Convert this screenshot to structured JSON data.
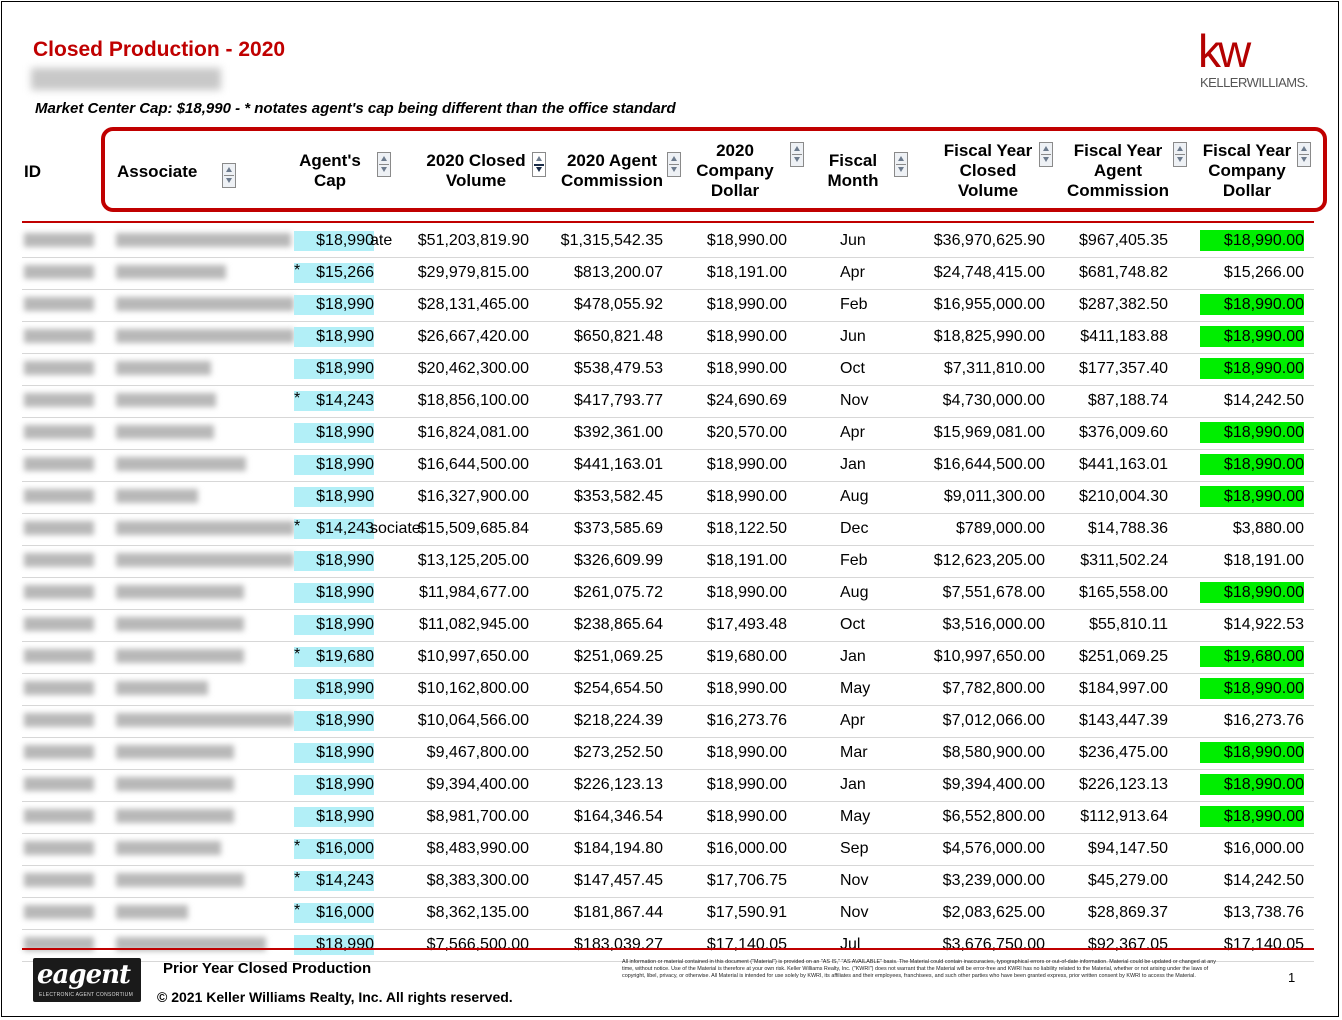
{
  "report": {
    "title": "Closed Production - 2020",
    "market_center_note": "Market Center Cap:  $18,990 - * notates agent's cap being different than the office standard"
  },
  "logo": {
    "mark": "kw",
    "text": "KELLERWILLIAMS."
  },
  "headers": {
    "id": "ID",
    "associate": "Associate",
    "agents_cap": [
      "Agent's",
      "Cap"
    ],
    "closed_volume": [
      "2020 Closed",
      "Volume"
    ],
    "agent_commission": [
      "2020 Agent",
      "Commission"
    ],
    "company_dollar": [
      "2020",
      "Company",
      "Dollar"
    ],
    "fiscal_month": [
      "Fiscal",
      "Month"
    ],
    "fy_closed_volume": [
      "Fiscal Year",
      "Closed",
      "Volume"
    ],
    "fy_agent_commission": [
      "Fiscal Year",
      "Agent",
      "Commission"
    ],
    "fy_company_dollar": [
      "Fiscal Year",
      "Company",
      "Dollar"
    ]
  },
  "rows": [
    {
      "star": "",
      "cap": "$18,990",
      "overlay": "ate",
      "vol": "$51,203,819.90",
      "comm": "$1,315,542.35",
      "cd": "$18,990.00",
      "month": "Jun",
      "fyvol": "$36,970,625.90",
      "fycomm": "$967,405.35",
      "fycd": "$18,990.00",
      "green": true,
      "nw": 175
    },
    {
      "star": "*",
      "cap": "$15,266",
      "overlay": "",
      "vol": "$29,979,815.00",
      "comm": "$813,200.07",
      "cd": "$18,191.00",
      "month": "Apr",
      "fyvol": "$24,748,415.00",
      "fycomm": "$681,748.82",
      "fycd": "$15,266.00",
      "green": false,
      "nw": 110
    },
    {
      "star": "",
      "cap": "$18,990",
      "overlay": "",
      "vol": "$28,131,465.00",
      "comm": "$478,055.92",
      "cd": "$18,990.00",
      "month": "Feb",
      "fyvol": "$16,955,000.00",
      "fycomm": "$287,382.50",
      "fycd": "$18,990.00",
      "green": true,
      "nw": 178
    },
    {
      "star": "",
      "cap": "$18,990",
      "overlay": "",
      "vol": "$26,667,420.00",
      "comm": "$650,821.48",
      "cd": "$18,990.00",
      "month": "Jun",
      "fyvol": "$18,825,990.00",
      "fycomm": "$411,183.88",
      "fycd": "$18,990.00",
      "green": true,
      "nw": 178
    },
    {
      "star": "",
      "cap": "$18,990",
      "overlay": "",
      "vol": "$20,462,300.00",
      "comm": "$538,479.53",
      "cd": "$18,990.00",
      "month": "Oct",
      "fyvol": "$7,311,810.00",
      "fycomm": "$177,357.40",
      "fycd": "$18,990.00",
      "green": true,
      "nw": 95
    },
    {
      "star": "*",
      "cap": "$14,243",
      "overlay": "",
      "vol": "$18,856,100.00",
      "comm": "$417,793.77",
      "cd": "$24,690.69",
      "month": "Nov",
      "fyvol": "$4,730,000.00",
      "fycomm": "$87,188.74",
      "fycd": "$14,242.50",
      "green": false,
      "nw": 100
    },
    {
      "star": "",
      "cap": "$18,990",
      "overlay": "",
      "vol": "$16,824,081.00",
      "comm": "$392,361.00",
      "cd": "$20,570.00",
      "month": "Apr",
      "fyvol": "$15,969,081.00",
      "fycomm": "$376,009.60",
      "fycd": "$18,990.00",
      "green": true,
      "nw": 98
    },
    {
      "star": "",
      "cap": "$18,990",
      "overlay": "",
      "vol": "$16,644,500.00",
      "comm": "$441,163.01",
      "cd": "$18,990.00",
      "month": "Jan",
      "fyvol": "$16,644,500.00",
      "fycomm": "$441,163.01",
      "fycd": "$18,990.00",
      "green": true,
      "nw": 130
    },
    {
      "star": "",
      "cap": "$18,990",
      "overlay": "",
      "vol": "$16,327,900.00",
      "comm": "$353,582.45",
      "cd": "$18,990.00",
      "month": "Aug",
      "fyvol": "$9,011,300.00",
      "fycomm": "$210,004.30",
      "fycd": "$18,990.00",
      "green": true,
      "nw": 82
    },
    {
      "star": "*",
      "cap": "$14,243",
      "overlay": "sociate",
      "vol": "$15,509,685.84",
      "comm": "$373,585.69",
      "cd": "$18,122.50",
      "month": "Dec",
      "fyvol": "$789,000.00",
      "fycomm": "$14,788.36",
      "fycd": "$3,880.00",
      "green": false,
      "nw": 178
    },
    {
      "star": "",
      "cap": "$18,990",
      "overlay": "",
      "vol": "$13,125,205.00",
      "comm": "$326,609.99",
      "cd": "$18,191.00",
      "month": "Feb",
      "fyvol": "$12,623,205.00",
      "fycomm": "$311,502.24",
      "fycd": "$18,191.00",
      "green": false,
      "nw": 178
    },
    {
      "star": "",
      "cap": "$18,990",
      "overlay": "",
      "vol": "$11,984,677.00",
      "comm": "$261,075.72",
      "cd": "$18,990.00",
      "month": "Aug",
      "fyvol": "$7,551,678.00",
      "fycomm": "$165,558.00",
      "fycd": "$18,990.00",
      "green": true,
      "nw": 128
    },
    {
      "star": "",
      "cap": "$18,990",
      "overlay": "",
      "vol": "$11,082,945.00",
      "comm": "$238,865.64",
      "cd": "$17,493.48",
      "month": "Oct",
      "fyvol": "$3,516,000.00",
      "fycomm": "$55,810.11",
      "fycd": "$14,922.53",
      "green": false,
      "nw": 128
    },
    {
      "star": "*",
      "cap": "$19,680",
      "overlay": "",
      "vol": "$10,997,650.00",
      "comm": "$251,069.25",
      "cd": "$19,680.00",
      "month": "Jan",
      "fyvol": "$10,997,650.00",
      "fycomm": "$251,069.25",
      "fycd": "$19,680.00",
      "green": true,
      "nw": 128
    },
    {
      "star": "",
      "cap": "$18,990",
      "overlay": "",
      "vol": "$10,162,800.00",
      "comm": "$254,654.50",
      "cd": "$18,990.00",
      "month": "May",
      "fyvol": "$7,782,800.00",
      "fycomm": "$184,997.00",
      "fycd": "$18,990.00",
      "green": true,
      "nw": 92
    },
    {
      "star": "",
      "cap": "$18,990",
      "overlay": "",
      "vol": "$10,064,566.00",
      "comm": "$218,224.39",
      "cd": "$16,273.76",
      "month": "Apr",
      "fyvol": "$7,012,066.00",
      "fycomm": "$143,447.39",
      "fycd": "$16,273.76",
      "green": false,
      "nw": 178
    },
    {
      "star": "",
      "cap": "$18,990",
      "overlay": "",
      "vol": "$9,467,800.00",
      "comm": "$273,252.50",
      "cd": "$18,990.00",
      "month": "Mar",
      "fyvol": "$8,580,900.00",
      "fycomm": "$236,475.00",
      "fycd": "$18,990.00",
      "green": true,
      "nw": 118
    },
    {
      "star": "",
      "cap": "$18,990",
      "overlay": "",
      "vol": "$9,394,400.00",
      "comm": "$226,123.13",
      "cd": "$18,990.00",
      "month": "Jan",
      "fyvol": "$9,394,400.00",
      "fycomm": "$226,123.13",
      "fycd": "$18,990.00",
      "green": true,
      "nw": 118
    },
    {
      "star": "",
      "cap": "$18,990",
      "overlay": "",
      "vol": "$8,981,700.00",
      "comm": "$164,346.54",
      "cd": "$18,990.00",
      "month": "May",
      "fyvol": "$6,552,800.00",
      "fycomm": "$112,913.64",
      "fycd": "$18,990.00",
      "green": true,
      "nw": 118
    },
    {
      "star": "*",
      "cap": "$16,000",
      "overlay": "",
      "vol": "$8,483,990.00",
      "comm": "$184,194.80",
      "cd": "$16,000.00",
      "month": "Sep",
      "fyvol": "$4,576,000.00",
      "fycomm": "$94,147.50",
      "fycd": "$16,000.00",
      "green": false,
      "nw": 105
    },
    {
      "star": "*",
      "cap": "$14,243",
      "overlay": "",
      "vol": "$8,383,300.00",
      "comm": "$147,457.45",
      "cd": "$17,706.75",
      "month": "Nov",
      "fyvol": "$3,239,000.00",
      "fycomm": "$45,279.00",
      "fycd": "$14,242.50",
      "green": false,
      "nw": 128
    },
    {
      "star": "*",
      "cap": "$16,000",
      "overlay": "",
      "vol": "$8,362,135.00",
      "comm": "$181,867.44",
      "cd": "$17,590.91",
      "month": "Nov",
      "fyvol": "$2,083,625.00",
      "fycomm": "$28,869.37",
      "fycd": "$13,738.76",
      "green": false,
      "nw": 72
    },
    {
      "star": "",
      "cap": "$18,990",
      "overlay": "",
      "vol": "$7,566,500.00",
      "comm": "$183,039.27",
      "cd": "$17,140.05",
      "month": "Jul",
      "fyvol": "$3,676,750.00",
      "fycomm": "$92,367.05",
      "fycd": "$17,140.05",
      "green": false,
      "nw": 150
    }
  ],
  "footer": {
    "brand": "eagent",
    "brand_sub": "ELECTRONIC AGENT CONSORTIUM",
    "title": "Prior Year Closed Production",
    "copyright": "© 2021 Keller Williams Realty, Inc.  All rights reserved.",
    "disclaimer": "All information or material contained in this document (\"Material\") is provided on an \"AS IS,\" \"AS AVAILABLE\" basis. The Material could contain inaccuracies, typographical errors or out-of-date information. Material could be updated or changed at any time, without notice. Use of the Material is therefore at your own risk. Keller Williams Realty, Inc. (\"KWRI\") does not warrant that the Material will be error-free and KWRI has no liability related to the Material, whether or not arising under the laws of copyright, libel, privacy, or otherwise. All Material is intended for use solely by KWRI, its affiliates and their employees, franchisees, and such other parties who have been granted express, prior written consent by KWRI to access the Material.",
    "page": "1"
  },
  "colors": {
    "title_red": "#c00000",
    "cap_cell": "#b2eff7",
    "green_cell": "#00ee00"
  }
}
